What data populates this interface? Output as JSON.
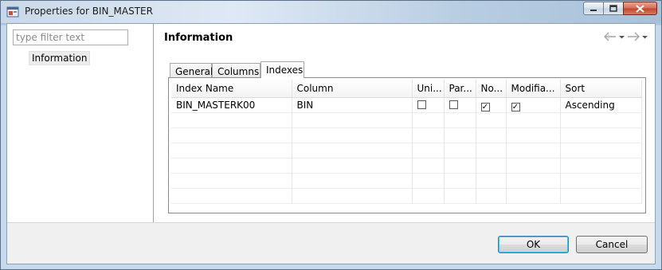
{
  "window": {
    "title": "Properties for BIN_MASTER"
  },
  "filter": {
    "placeholder": "type filter text"
  },
  "tree": {
    "items": [
      "Information"
    ]
  },
  "page": {
    "title": "Information"
  },
  "tabs": [
    {
      "label": "General",
      "active": false
    },
    {
      "label": "Columns",
      "active": false
    },
    {
      "label": "Indexes",
      "active": true
    }
  ],
  "table": {
    "headers": [
      "Index Name",
      "Column",
      "Uni...",
      "Par...",
      "No...",
      "Modifia...",
      "Sort"
    ],
    "rows": [
      {
        "index_name": "BIN_MASTERK00",
        "column": "BIN",
        "unique": false,
        "partition": false,
        "not_null": true,
        "modifiable": true,
        "sort": "Ascending"
      }
    ],
    "empty_rows": 6
  },
  "buttons": {
    "ok": "OK",
    "cancel": "Cancel"
  },
  "icons": {
    "back": "back-arrow-icon",
    "forward": "forward-arrow-icon",
    "dropdown": "chevron-down-icon"
  },
  "colors": {
    "accent": "#3c7fb1",
    "close": "#c2452c"
  }
}
